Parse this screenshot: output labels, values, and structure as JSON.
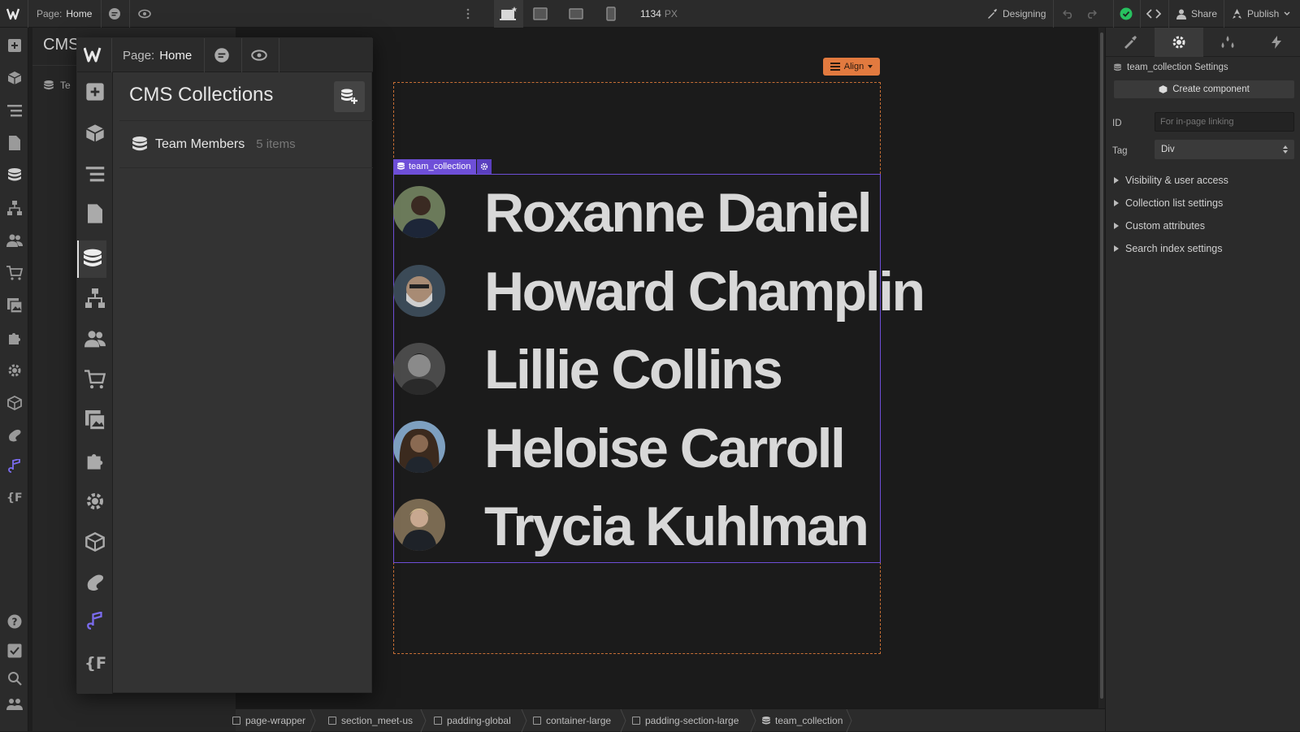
{
  "topbar": {
    "page_label": "Page:",
    "page_name": "Home",
    "width_value": "1134",
    "width_unit": "PX",
    "mode": "Designing",
    "share": "Share",
    "publish": "Publish"
  },
  "bg_panel": {
    "title": "CMS",
    "row_fragment": "Te"
  },
  "float_panel": {
    "page_label": "Page:",
    "page_name": "Home",
    "title": "CMS Collections",
    "collection": {
      "name": "Team Members",
      "count": "5 items"
    }
  },
  "canvas": {
    "align_button": "Align",
    "selection_tag": "team_collection",
    "members": [
      {
        "name": "Roxanne Daniel",
        "avatar_color": "#6b7a5a"
      },
      {
        "name": "Howard Champlin",
        "avatar_color": "#3b4a57"
      },
      {
        "name": "Lillie Collins",
        "avatar_color": "#4a4a4a"
      },
      {
        "name": "Heloise Carroll",
        "avatar_color": "#5a4a3e"
      },
      {
        "name": "Trycia Kuhlman",
        "avatar_color": "#7a6a52"
      }
    ]
  },
  "right_panel": {
    "settings_title": "team_collection Settings",
    "create_component": "Create component",
    "id_label": "ID",
    "id_placeholder": "For in-page linking",
    "tag_label": "Tag",
    "tag_value": "Div",
    "sections": [
      "Visibility & user access",
      "Collection list settings",
      "Custom attributes",
      "Search index settings"
    ]
  },
  "breadcrumb": [
    "page-wrapper",
    "section_meet-us",
    "padding-global",
    "container-large",
    "padding-section-large",
    "team_collection"
  ],
  "colors": {
    "accent_purple": "#6e4fd8",
    "align_orange": "#e27a3f",
    "status_green": "#27c15f"
  }
}
